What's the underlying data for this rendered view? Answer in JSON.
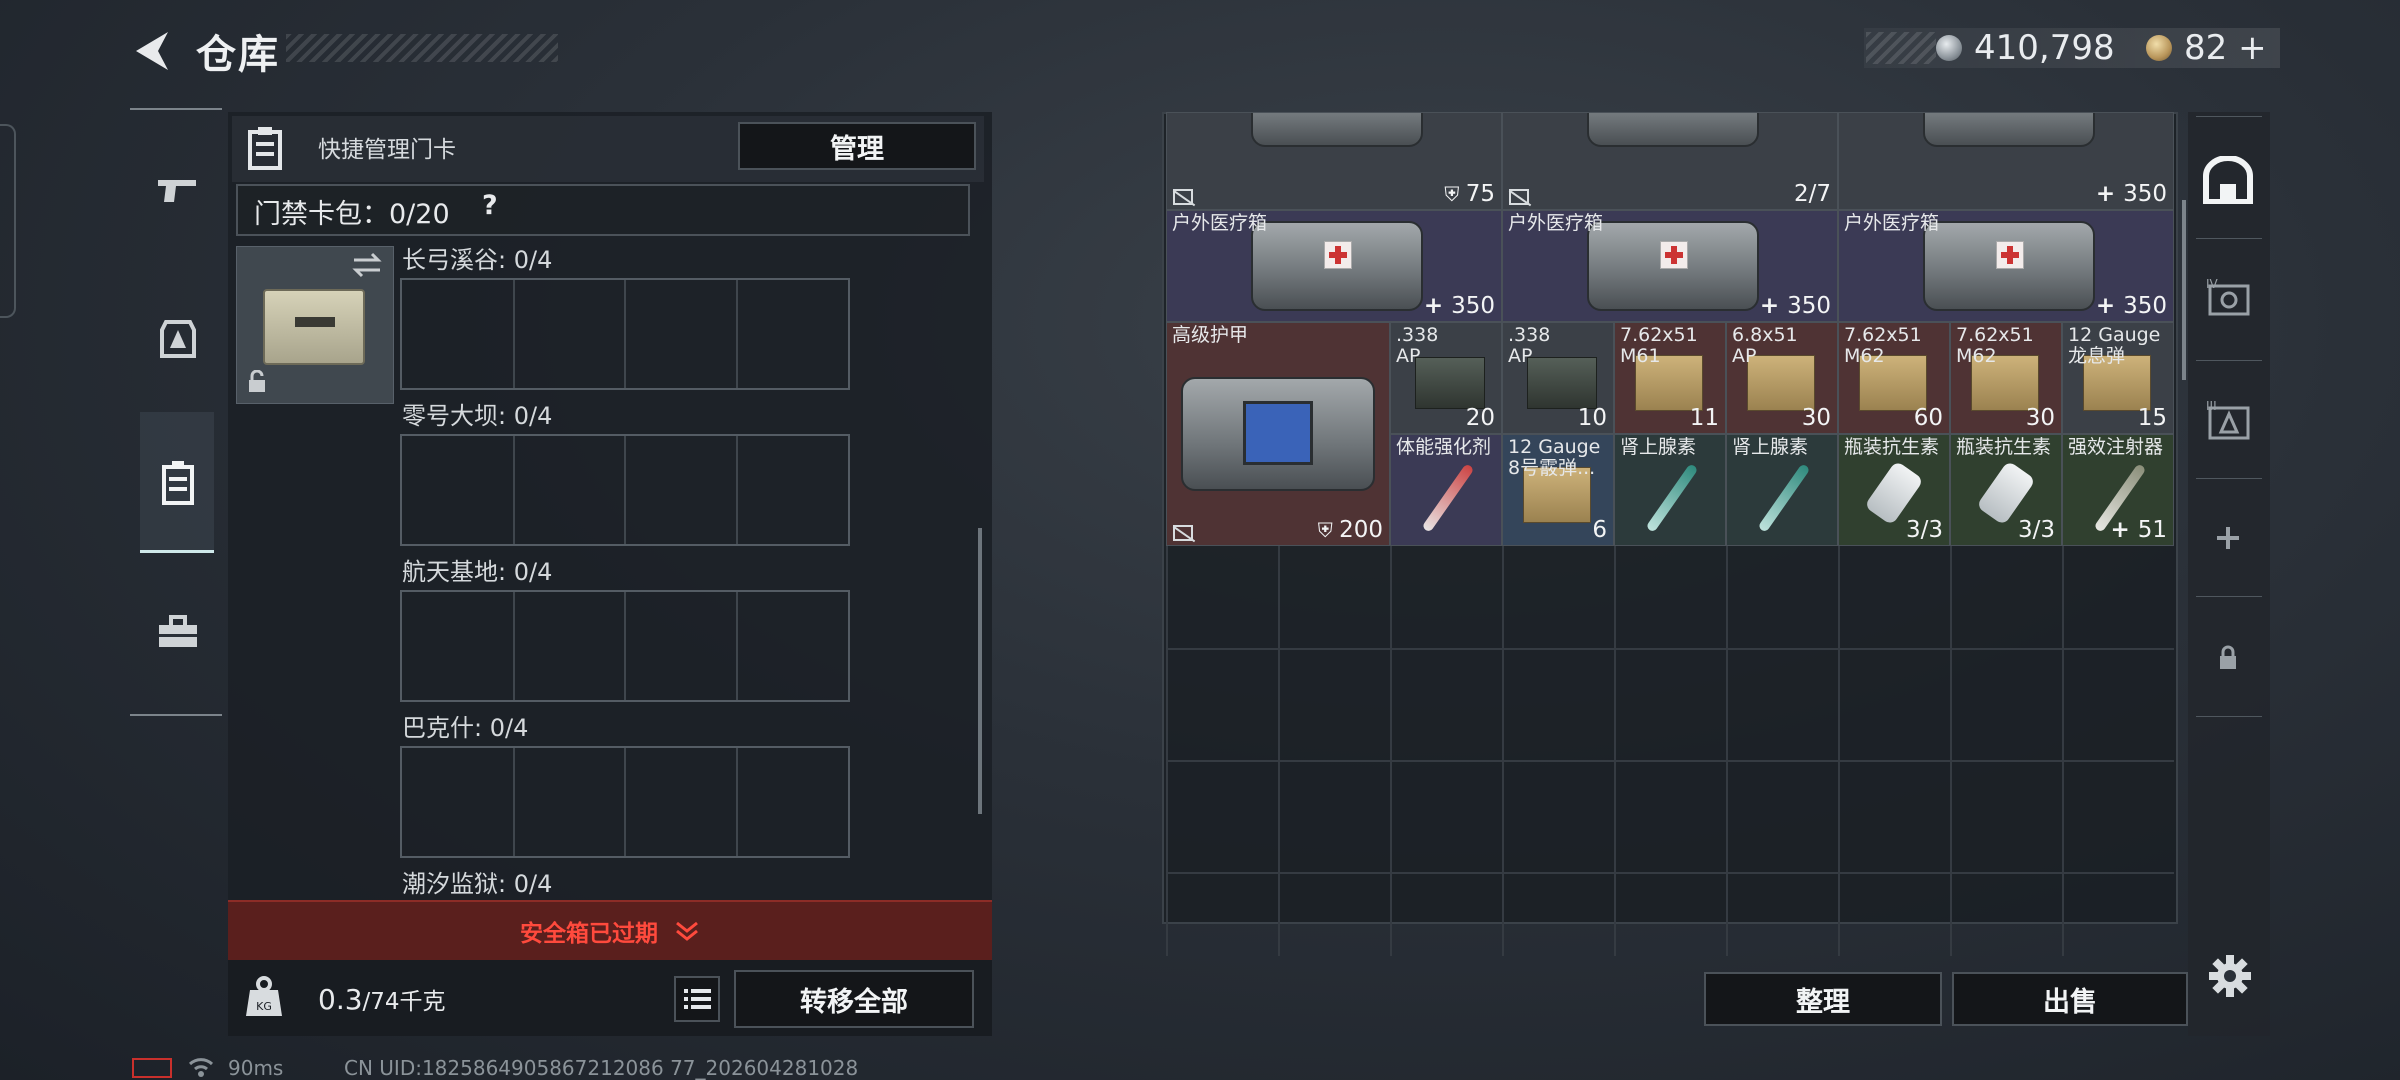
{
  "header": {
    "title": "仓库",
    "silver_amount": "410,798",
    "token_amount": "82",
    "token_plus": "+"
  },
  "left_sidebar": {
    "items": [
      {
        "name": "weapon-tab-icon",
        "active": false
      },
      {
        "name": "gear-tab-icon",
        "active": false
      },
      {
        "name": "card-tab-icon",
        "active": true
      },
      {
        "name": "toolbox-tab-icon",
        "active": false
      }
    ]
  },
  "card_panel": {
    "head_label": "快捷管理门卡",
    "manage_label": "管理",
    "keybag_label": "门禁卡包：0/20",
    "keybag_help": "?",
    "maps": [
      {
        "label": "长弓溪谷: 0/4"
      },
      {
        "label": "零号大坝: 0/4"
      },
      {
        "label": "航天基地: 0/4"
      },
      {
        "label": "巴克什: 0/4"
      },
      {
        "label": "潮汐监狱: 0/4"
      }
    ],
    "expired_text": "安全箱已过期",
    "weight_value": "0.3",
    "weight_max": "/74千克",
    "transfer_label": "转移全部"
  },
  "stash": {
    "items": [
      {
        "name": "",
        "count": "75",
        "badge": "shield",
        "bg": "gray"
      },
      {
        "name": "",
        "count": "2/7",
        "badge": "none",
        "bg": "gray"
      },
      {
        "name": "",
        "count": "350",
        "badge": "plus",
        "bg": "gray"
      },
      {
        "name": "户外医疗箱",
        "count": "350",
        "badge": "plus",
        "bg": "purple"
      },
      {
        "name": "户外医疗箱",
        "count": "350",
        "badge": "plus",
        "bg": "purple"
      },
      {
        "name": "户外医疗箱",
        "count": "350",
        "badge": "plus",
        "bg": "purple"
      },
      {
        "name": "高级护甲",
        "count": "200",
        "badge": "shield",
        "bg": "red"
      },
      {
        "name": ".338\nAP",
        "count": "20",
        "bg": "gray"
      },
      {
        "name": ".338\nAP",
        "count": "10",
        "bg": "gray"
      },
      {
        "name": "7.62x51\nM61",
        "count": "11",
        "bg": "red"
      },
      {
        "name": "6.8x51\nAP",
        "count": "30",
        "bg": "red"
      },
      {
        "name": "7.62x51\nM62",
        "count": "60",
        "bg": "red"
      },
      {
        "name": "7.62x51\nM62",
        "count": "30",
        "bg": "red"
      },
      {
        "name": "12 Gauge\n龙息弹",
        "count": "15",
        "bg": "gray"
      },
      {
        "name": "体能强化剂",
        "count": "",
        "bg": "purple"
      },
      {
        "name": "12 Gauge\n8号霰弹...",
        "count": "6",
        "bg": "blue"
      },
      {
        "name": "肾上腺素",
        "count": "",
        "bg": "teal"
      },
      {
        "name": "肾上腺素",
        "count": "",
        "bg": "teal"
      },
      {
        "name": "瓶装抗生素",
        "count": "3/3",
        "bg": "dgreen"
      },
      {
        "name": "瓶装抗生素",
        "count": "3/3",
        "bg": "dgreen"
      },
      {
        "name": "强效注射器",
        "count": "51",
        "badge": "plus",
        "bg": "dgreen"
      }
    ],
    "sort_label": "整理",
    "sell_label": "出售"
  },
  "status_bar": {
    "ping": "90ms",
    "uid": "CN UID:1825864905867212086 77_202604281028"
  },
  "colors": {
    "accent_active": "#cfe9ea",
    "expired_red": "#ff4a3d",
    "bg_dark": "#1b1f25"
  }
}
